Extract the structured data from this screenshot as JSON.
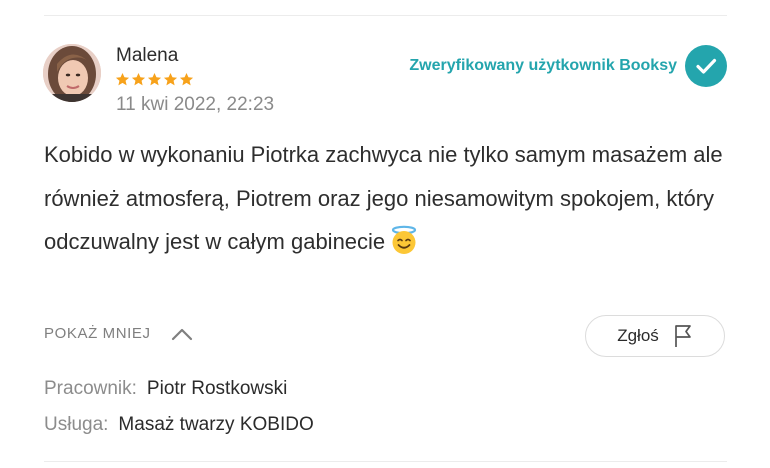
{
  "review": {
    "author": "Malena",
    "rating": 5,
    "date": "11 kwi 2022, 22:23",
    "verified_label": "Zweryfikowany użytkownik Booksy",
    "text": "Kobido w wykonaniu Piotrka zachwyca nie tylko samym masażem ale również atmosferą, Piotrem oraz jego niesamowitym spokojem, który odczuwalny jest w całym gabinecie",
    "emoji": "smiling-face-with-halo",
    "toggle_label": "POKAŻ MNIEJ",
    "report_label": "Zgłoś",
    "employee_key": "Pracownik:",
    "employee_value": "Piotr Rostkowski",
    "service_key": "Usługa:",
    "service_value": "Masaż twarzy KOBIDO"
  },
  "colors": {
    "accent": "#24a5ad",
    "stars": "#f7a21b",
    "muted": "#8a8a8a"
  },
  "icons": [
    "star-icon",
    "verified-check-icon",
    "chevron-up-icon",
    "flag-icon",
    "halo-emoji-icon"
  ]
}
